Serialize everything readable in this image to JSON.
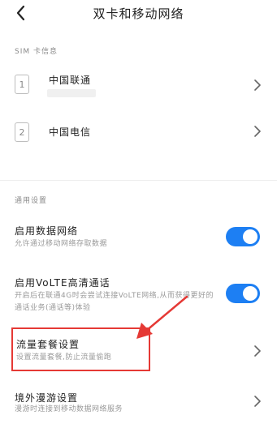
{
  "header": {
    "title": "双卡和移动网络"
  },
  "sim_section": {
    "label": "SIM 卡信息",
    "cards": [
      {
        "slot": "1",
        "carrier": "中国联通"
      },
      {
        "slot": "2",
        "carrier": "中国电信"
      }
    ]
  },
  "general_section": {
    "label": "通用设置",
    "items": [
      {
        "title": "启用数据网络",
        "subtitle": "允许通过移动网络存取数据",
        "toggle_on": true
      },
      {
        "title": "启用VoLTE高清通话",
        "subtitle": "开启后在联通4G时会尝试连接VoLTE网络,从而获得更好的通话业务(通话等)体验",
        "toggle_on": true
      },
      {
        "title": "流量套餐设置",
        "subtitle": "设置流量套餐,防止流量偷跑"
      },
      {
        "title": "境外漫游设置",
        "subtitle": "漫游时连接到移动数据网络服务"
      }
    ]
  },
  "colors": {
    "accent": "#1d7ff3",
    "annotation": "#e53935"
  },
  "icons": [
    "back-arrow-icon",
    "chevron-right-icon"
  ]
}
